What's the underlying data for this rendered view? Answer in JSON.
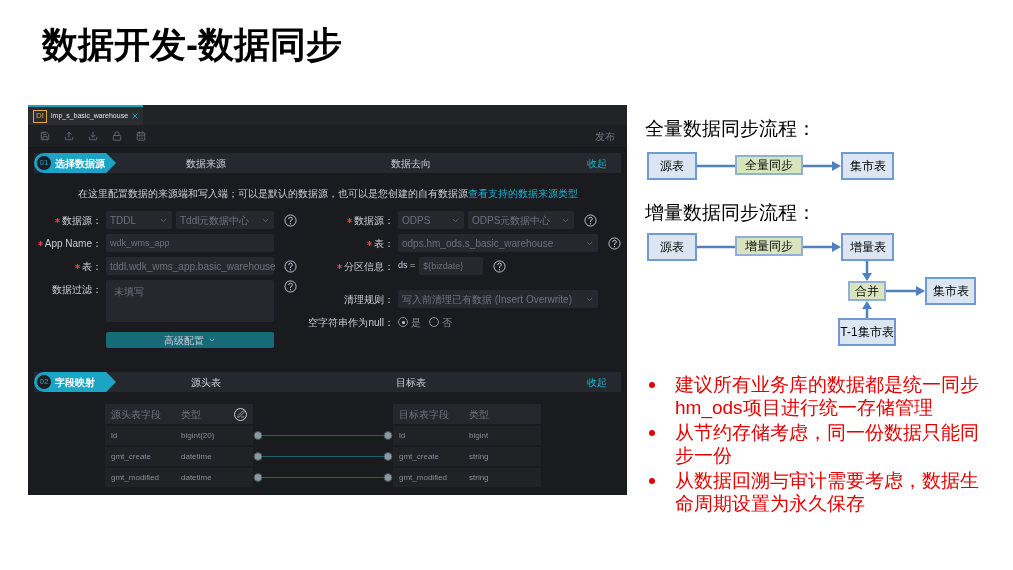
{
  "slide_title": "数据开发-数据同步",
  "editor": {
    "tab": {
      "icon_label": "DI",
      "title": "imp_s_basic_warehouse",
      "selected": true
    },
    "toolbar": {
      "publish": "发布"
    },
    "step1": {
      "number": "01",
      "title": "选择数据源",
      "source_heading": "数据来源",
      "target_heading": "数据去向",
      "collapse": "收起"
    },
    "intro": {
      "text": "在这里配置数据的来源端和写入端；可以是默认的数据源，也可以是您创建的自有数据源",
      "link": "查看支持的数据来源类型"
    },
    "source_fields": [
      {
        "kind": "select",
        "label": "数据源：",
        "required": true,
        "value": "TDDL",
        "value2": "Tddl元数据中心",
        "help": true
      },
      {
        "kind": "input",
        "label": "App Name：",
        "required": true,
        "value": "wdk_wms_app",
        "help": false
      },
      {
        "kind": "select",
        "label": "表：",
        "required": true,
        "value": "tddl.wdk_wms_app.basic_warehouse",
        "help": true
      },
      {
        "kind": "textarea",
        "label": "数据过滤：",
        "required": false,
        "placeholder": "未填写",
        "help": true
      }
    ],
    "advanced_button": "高级配置",
    "target_fields": [
      {
        "kind": "select",
        "label": "数据源：",
        "required": true,
        "value": "ODPS",
        "value2": "ODPS元数据中心",
        "help": true
      },
      {
        "kind": "select",
        "label": "表：",
        "required": true,
        "value": "odps.hm_ods.s_basic_warehouse",
        "help": true
      },
      {
        "kind": "partition",
        "label": "分区信息：",
        "required": true,
        "prefix": "ds =",
        "value": "${bizdate}",
        "help": true
      },
      {
        "kind": "select",
        "label": "清理规则：",
        "required": false,
        "value": "写入前清理已有数据 (Insert Overwrite)",
        "help": false
      },
      {
        "kind": "radio",
        "label": "空字符串作为null：",
        "required": false,
        "help": false,
        "options": [
          {
            "label": "是",
            "selected": true
          },
          {
            "label": "否",
            "selected": false
          }
        ]
      }
    ],
    "step2": {
      "number": "02",
      "title": "字段映射",
      "source_heading": "源头表",
      "target_heading": "目标表",
      "collapse": "收起"
    },
    "mapping": {
      "source_columns": [
        "源头表字段",
        "类型"
      ],
      "target_columns": [
        "目标表字段",
        "类型"
      ],
      "rows": [
        {
          "source_field": "id",
          "source_type": "bigint(20)",
          "target_field": "id",
          "target_type": "bigint"
        },
        {
          "source_field": "gmt_create",
          "source_type": "datetime",
          "target_field": "gmt_create",
          "target_type": "string"
        },
        {
          "source_field": "gmt_modified",
          "source_type": "datetime",
          "target_field": "gmt_modified",
          "target_type": "string"
        }
      ]
    }
  },
  "full_flow": {
    "title": "全量数据同步流程：",
    "source": "源表",
    "step": "全量同步",
    "target": "集市表"
  },
  "incremental_flow": {
    "title": "增量数据同步流程：",
    "source": "源表",
    "step": "增量同步",
    "increment": "增量表",
    "merge": "合并",
    "target": "集市表",
    "previous": "T-1集市表"
  },
  "notes": [
    "建议所有业务库的数据都是统一同步hm_ods项目进行统一存储管理",
    "从节约存储考虑，同一份数据只能同步一份",
    "从数据回溯与审计需要考虑，数据生命周期设置为永久保存"
  ]
}
